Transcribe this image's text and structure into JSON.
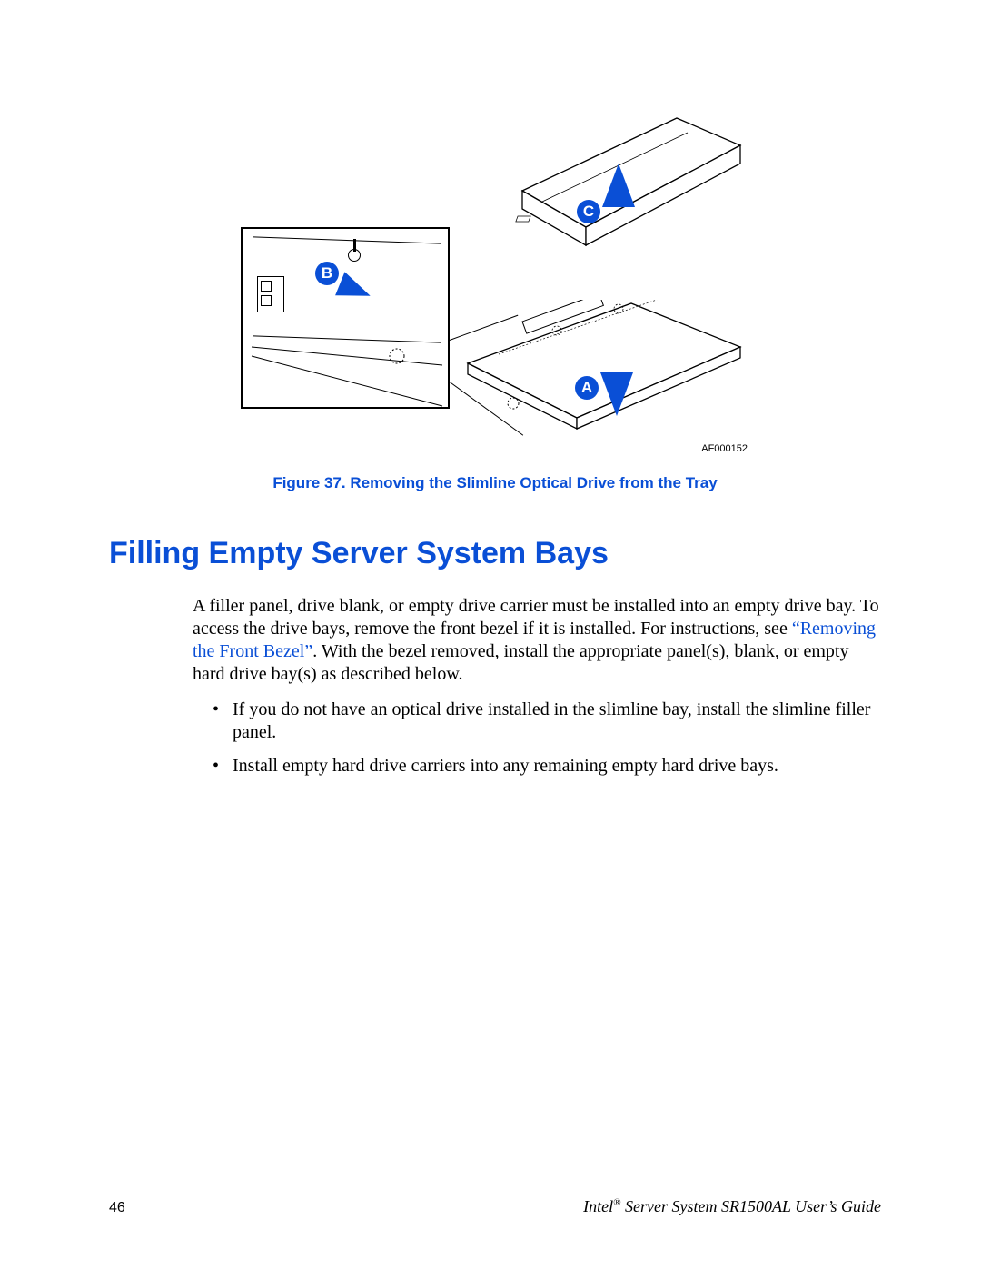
{
  "figure": {
    "callout_a": "A",
    "callout_b": "B",
    "callout_c": "C",
    "af_code": "AF000152",
    "caption": "Figure 37. Removing the Slimline Optical Drive from the Tray"
  },
  "section": {
    "heading": "Filling Empty Server System Bays",
    "para_part1": "A filler panel, drive blank, or empty drive carrier must be installed into an empty drive bay. To access the drive bays, remove the front bezel if it is installed. For instructions, see ",
    "link_text": "“Removing the Front Bezel”",
    "para_part2": ". With the bezel removed, install the appropriate panel(s), blank, or empty hard drive bay(s) as described below.",
    "bullets": [
      "If you do not have an optical drive installed in the slimline bay, install the slimline filler panel.",
      "Install empty hard drive carriers into any remaining empty hard drive bays."
    ]
  },
  "footer": {
    "page_number": "46",
    "brand": "Intel",
    "reg": "®",
    "guide_rest": " Server System SR1500AL User’s Guide"
  }
}
